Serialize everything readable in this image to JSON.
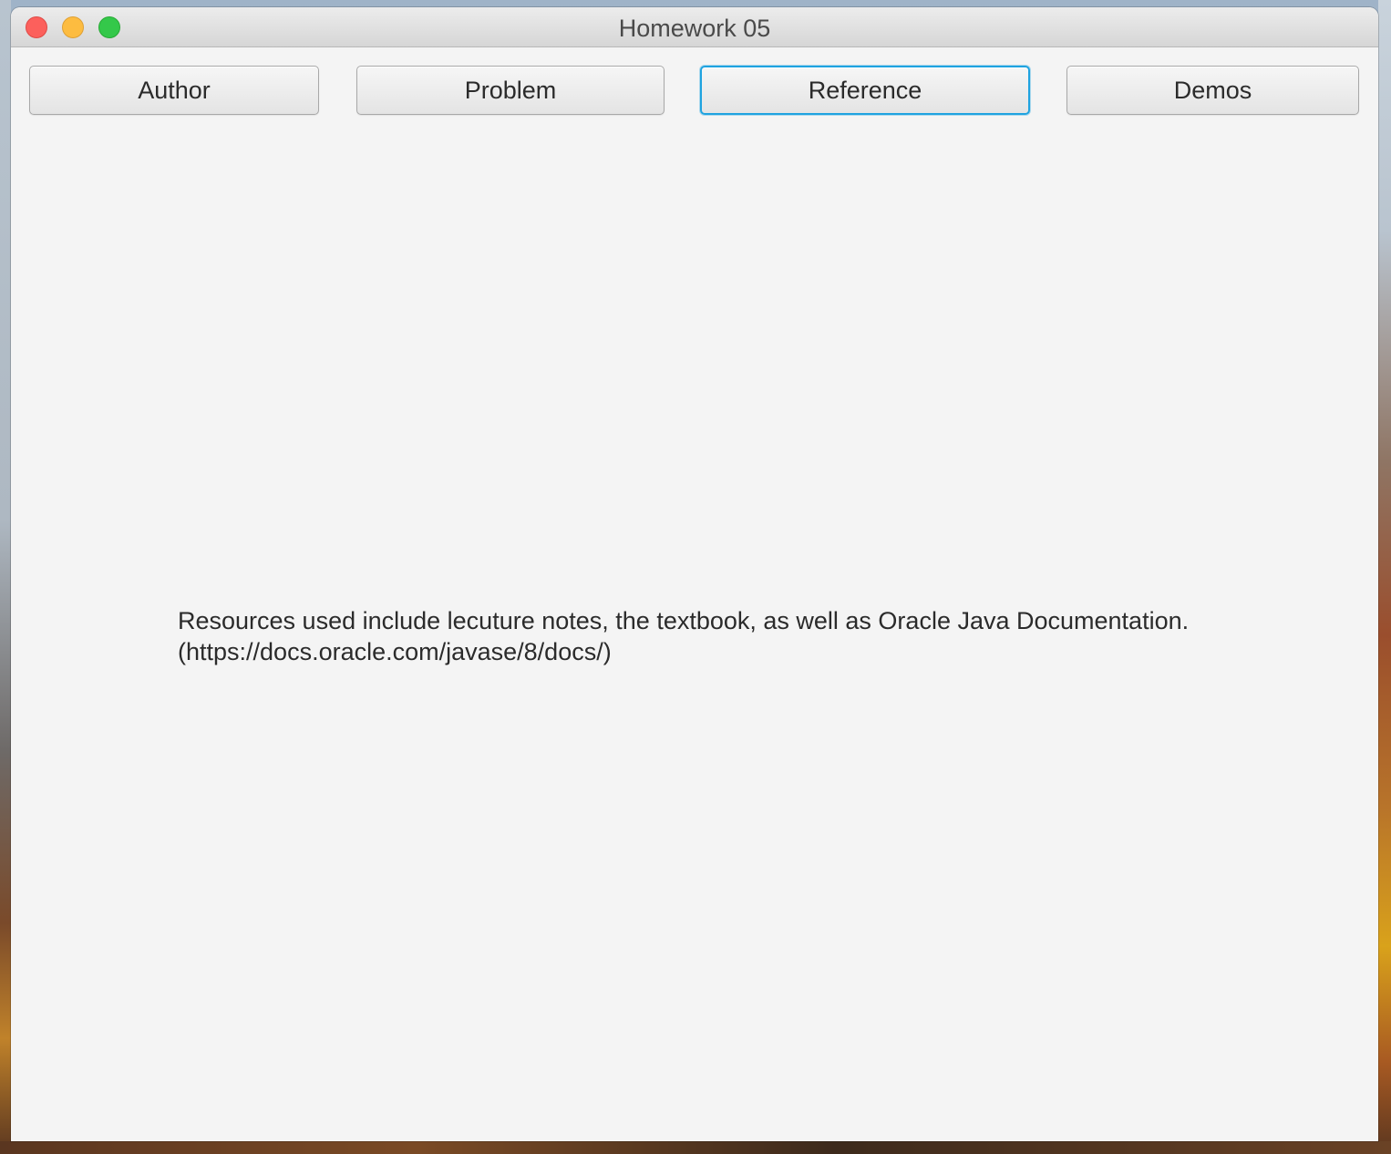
{
  "window": {
    "title": "Homework 05"
  },
  "toolbar": {
    "buttons": [
      {
        "label": "Author"
      },
      {
        "label": "Problem"
      },
      {
        "label": "Reference"
      },
      {
        "label": "Demos"
      }
    ],
    "focused": "Reference",
    "focus_color": "#1fa3e0"
  },
  "main": {
    "reference_line1": "Resources used include lecuture notes, the textbook, as well as Oracle Java Documentation.",
    "reference_line2": "(https://docs.oracle.com/javase/8/docs/)"
  },
  "icons": {
    "close": "close-icon",
    "minimize": "minimize-icon",
    "zoom": "zoom-icon"
  },
  "colors": {
    "close": "#fc605c",
    "minimize": "#fdbc40",
    "zoom": "#34c84a",
    "window_bg": "#f4f4f4"
  }
}
